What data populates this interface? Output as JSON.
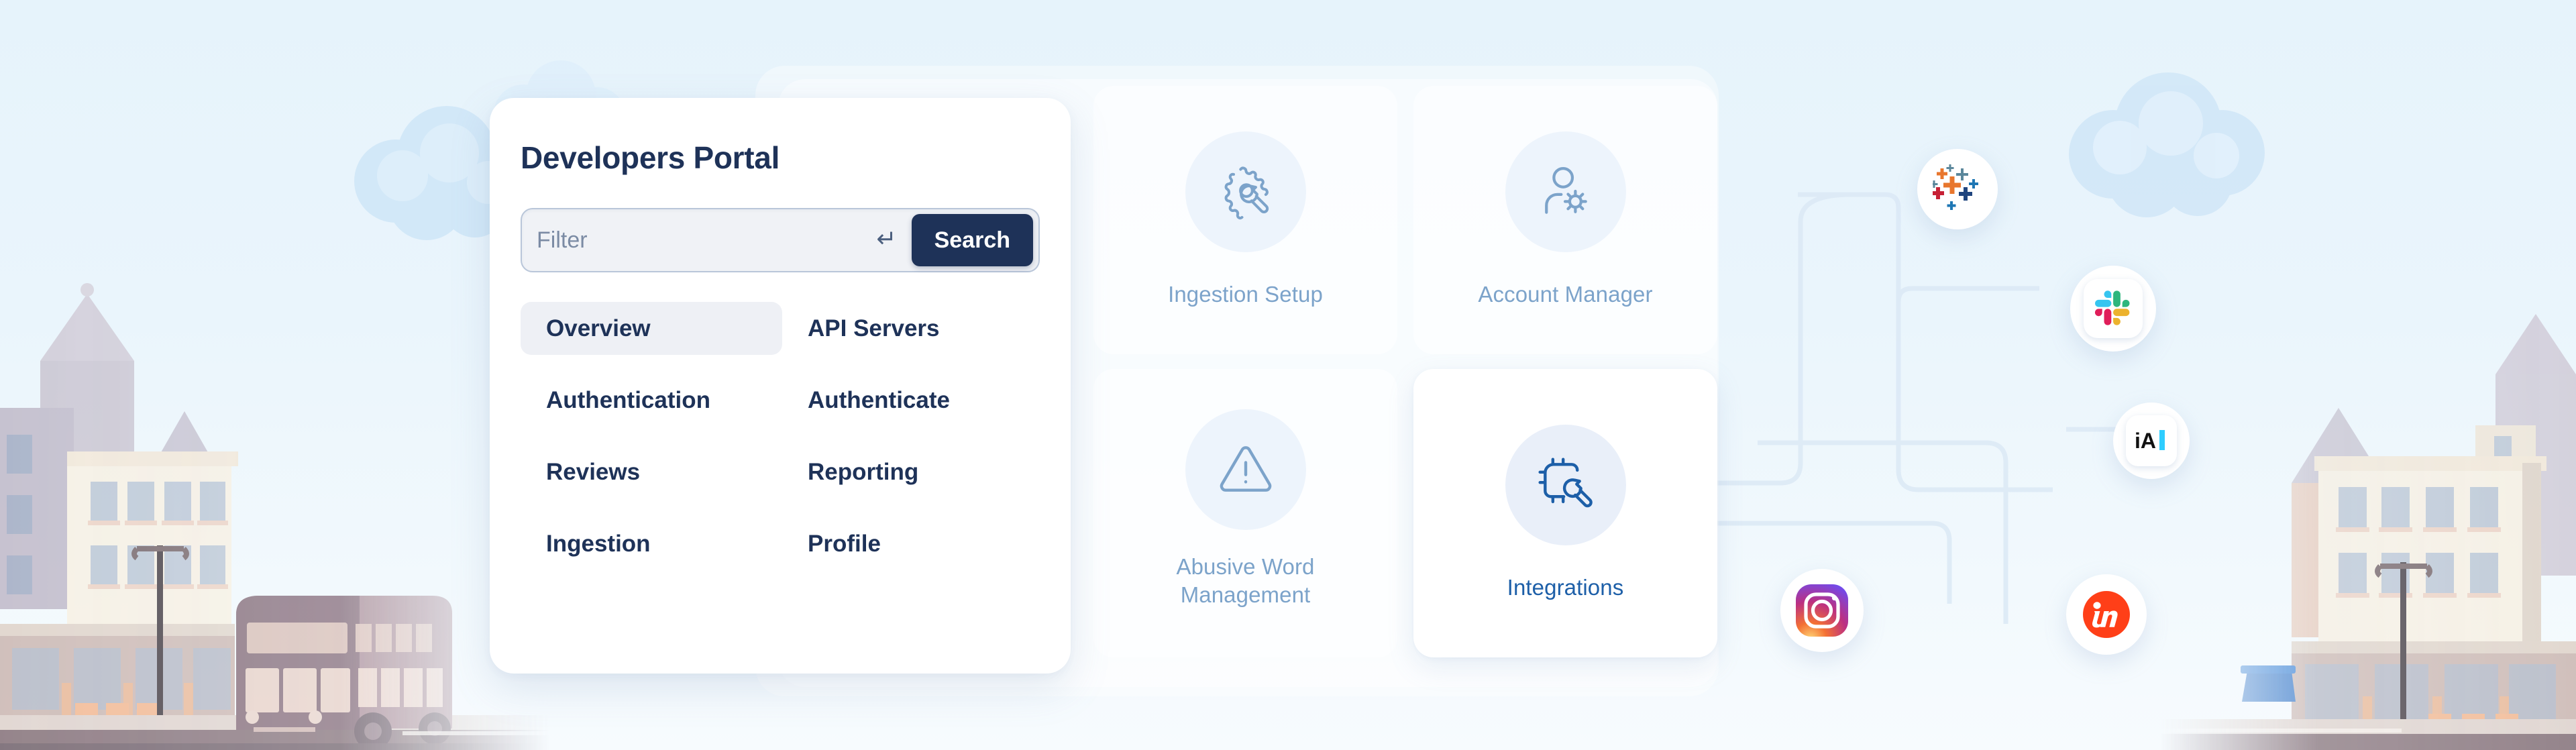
{
  "theme": {
    "background_top": "#e6f3fb",
    "background_bottom": "#f7fbfe",
    "navy": "#1e3258",
    "tile_label": "#7ca3ca",
    "tile_active_label": "#1d5fa8",
    "card_white": "#ffffff",
    "selected_nav_bg": "#eef0f5"
  },
  "card": {
    "title": "Developers Portal",
    "search": {
      "placeholder": "Filter",
      "value": "",
      "enter_hint_icon": "enter-return-icon",
      "button_label": "Search"
    },
    "nav_items": [
      {
        "label": "Overview",
        "selected": true
      },
      {
        "label": "API Servers",
        "selected": false
      },
      {
        "label": "Authentication",
        "selected": false
      },
      {
        "label": "Authenticate",
        "selected": false
      },
      {
        "label": "Reviews",
        "selected": false
      },
      {
        "label": "Reporting",
        "selected": false
      },
      {
        "label": "Ingestion",
        "selected": false
      },
      {
        "label": "Profile",
        "selected": false
      }
    ]
  },
  "tiles": [
    {
      "label": "Ingestion Setup",
      "icon": "gear-wrench-icon",
      "active": false
    },
    {
      "label": "Account Manager",
      "icon": "user-gear-icon",
      "active": false
    },
    {
      "label": "Abusive Word Management",
      "icon": "warning-triangle-icon",
      "active": false
    },
    {
      "label": "Integrations",
      "icon": "chip-wrench-icon",
      "active": true
    }
  ],
  "logo_badges": [
    {
      "name": "tableau-logo",
      "label": "Tableau"
    },
    {
      "name": "slack-logo",
      "label": "Slack"
    },
    {
      "name": "ia-writer-logo",
      "label": "iA"
    },
    {
      "name": "instagram-logo",
      "label": "Instagram"
    },
    {
      "name": "invision-logo",
      "label": "in"
    }
  ],
  "scenery": {
    "left_illustration": "city-street-with-double-decker-bus",
    "right_illustration": "city-street-with-recycling-bin",
    "clouds": 3
  }
}
